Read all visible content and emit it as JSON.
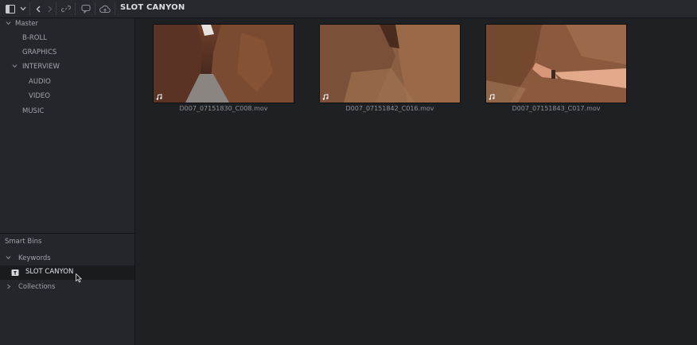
{
  "toolbar": {
    "title": "SLOT CANYON",
    "icons": [
      "sidebar-toggle-icon",
      "chevron-down-icon",
      "back-icon",
      "forward-icon",
      "link-icon",
      "chat-icon",
      "cloud-icon"
    ]
  },
  "sidebar": {
    "tree": [
      {
        "label": "Master",
        "expanded": true
      },
      {
        "label": "B-ROLL"
      },
      {
        "label": "GRAPHICS"
      },
      {
        "label": "INTERVIEW",
        "expanded": true
      },
      {
        "label": "AUDIO"
      },
      {
        "label": "VIDEO"
      },
      {
        "label": "MUSIC"
      }
    ],
    "smart_bins": {
      "title": "Smart Bins",
      "keywords": "Keywords",
      "selected": "SLOT CANYON",
      "collections": "Collections"
    }
  },
  "clips": [
    {
      "name": "D007_07151830_C008.mov"
    },
    {
      "name": "D007_07151842_C016.mov"
    },
    {
      "name": "D007_07151843_C017.mov"
    }
  ]
}
